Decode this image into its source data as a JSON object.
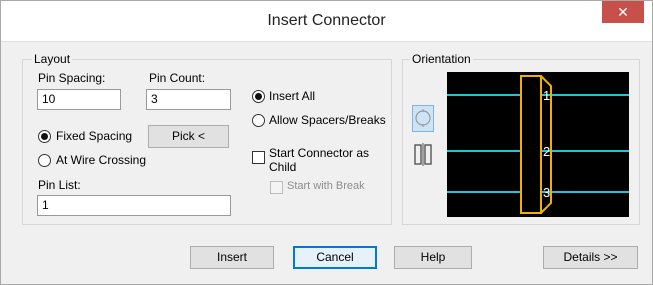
{
  "dialog": {
    "title": "Insert Connector",
    "close_glyph": "✕"
  },
  "layout": {
    "group_label": "Layout",
    "pin_spacing_label": "Pin Spacing:",
    "pin_spacing_value": "10",
    "pin_count_label": "Pin Count:",
    "pin_count_value": "3",
    "fixed_spacing_label": "Fixed Spacing",
    "at_wire_crossing_label": "At Wire Crossing",
    "pick_button": "Pick <",
    "pin_list_label": "Pin List:",
    "pin_list_value": "1",
    "insert_all_label": "Insert All",
    "allow_spacers_label": "Allow Spacers/Breaks",
    "start_connector_label_line1": "Start Connector as",
    "start_connector_label_line2": "Child",
    "start_with_break_label": "Start with Break"
  },
  "orientation": {
    "group_label": "Orientation",
    "pin_numbers": [
      "1",
      "2",
      "3"
    ],
    "colors": {
      "wire": "#22c3d8",
      "connector": "#f0b000",
      "pin_number": "#ffffff",
      "background": "#000000"
    }
  },
  "footer": {
    "insert_button": "Insert",
    "cancel_button": "Cancel",
    "help_button": "Help",
    "details_button": "Details >>"
  }
}
